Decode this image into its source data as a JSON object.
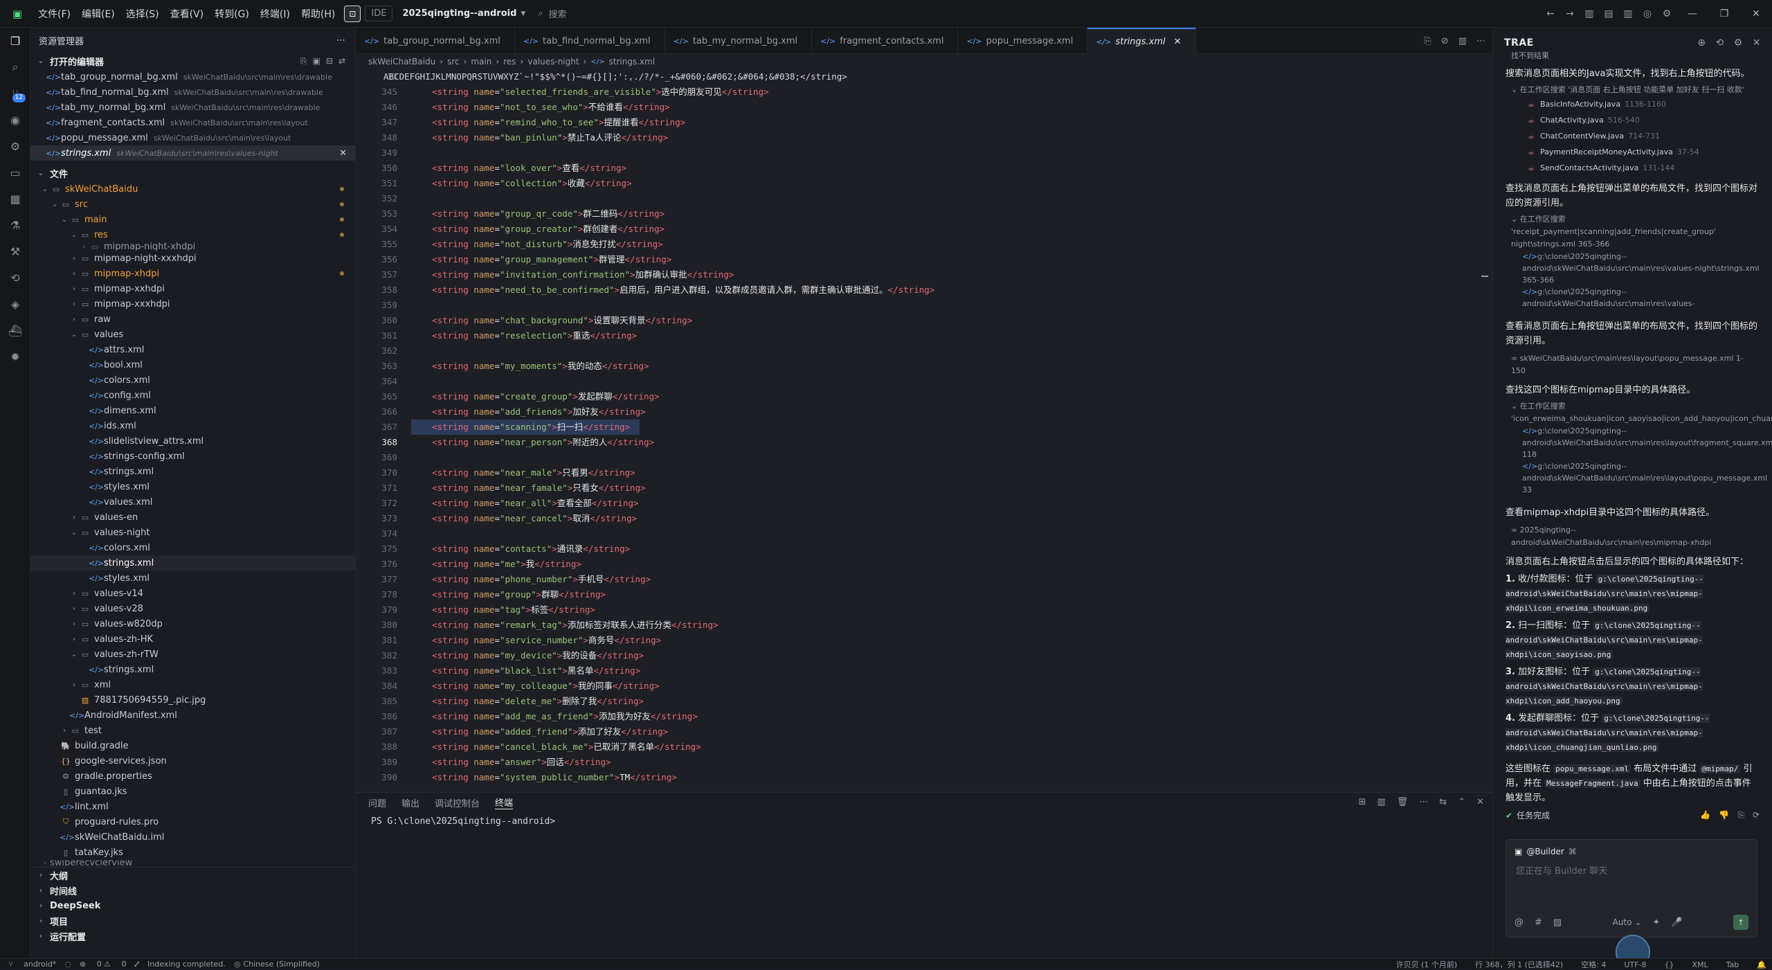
{
  "titlebar": {
    "menus": [
      "文件(F)",
      "编辑(E)",
      "选择(S)",
      "查看(V)",
      "转到(G)",
      "终端(I)",
      "帮助(H)"
    ],
    "ide_label": "IDE",
    "project": "2025qingting--android",
    "search_placeholder": "搜索"
  },
  "sidebar": {
    "title": "资源管理器",
    "open_editors_title": "打开的编辑器",
    "open_editors": [
      {
        "name": "tab_group_normal_bg.xml",
        "path": "skWeiChatBaidu\\src\\main\\res\\drawable"
      },
      {
        "name": "tab_find_normal_bg.xml",
        "path": "skWeiChatBaidu\\src\\main\\res\\drawable"
      },
      {
        "name": "tab_my_normal_bg.xml",
        "path": "skWeiChatBaidu\\src\\main\\res\\drawable"
      },
      {
        "name": "fragment_contacts.xml",
        "path": "skWeiChatBaidu\\src\\main\\res\\layout"
      },
      {
        "name": "popu_message.xml",
        "path": "skWeiChatBaidu\\src\\main\\res\\layout"
      },
      {
        "name": "strings.xml",
        "path": "skWeiChatBaidu\\src\\main\\res\\values-night"
      }
    ],
    "files_title": "文件",
    "tree": {
      "root": "skWeiChatBaidu",
      "src": "src",
      "main": "main",
      "res": "res",
      "mipmap_night_xhdpi": "mipmap-night-xhdpi",
      "mipmap_night_xxxhdpi": "mipmap-night-xxxhdpi",
      "mipmap_xhdpi": "mipmap-xhdpi",
      "mipmap_xxhdpi": "mipmap-xxhdpi",
      "mipmap_xxxhdpi": "mipmap-xxxhdpi",
      "raw": "raw",
      "values": "values",
      "values_files": [
        "attrs.xml",
        "bool.xml",
        "colors.xml",
        "config.xml",
        "dimens.xml",
        "ids.xml",
        "slidelistview_attrs.xml",
        "strings-config.xml",
        "strings.xml",
        "styles.xml",
        "values.xml"
      ],
      "values_en": "values-en",
      "values_night": "values-night",
      "values_night_files": [
        "colors.xml",
        "strings.xml",
        "styles.xml"
      ],
      "values_v14": "values-v14",
      "values_v28": "values-v28",
      "values_w820dp": "values-w820dp",
      "values_zh_hk": "values-zh-HK",
      "values_zh_rtw": "values-zh-rTW",
      "zh_rtw_strings": "strings.xml",
      "xml": "xml",
      "pic": "7881750694559_.pic.jpg",
      "manifest": "AndroidManifest.xml",
      "test": "test",
      "root_files": [
        "build.gradle",
        "google-services.json",
        "gradle.properties",
        "guantao.jks",
        "lint.xml",
        "proguard-rules.pro",
        "skWeiChatBaidu.iml",
        "tataKey.jks"
      ],
      "cut_folder": "swiperecyclerview"
    },
    "bottom_sections": [
      "大纲",
      "时间线",
      "DeepSeek",
      "项目",
      "运行配置"
    ]
  },
  "editor": {
    "tabs": [
      "tab_group_normal_bg.xml",
      "tab_find_normal_bg.xml",
      "tab_my_normal_bg.xml",
      "fragment_contacts.xml",
      "popu_message.xml",
      "strings.xml"
    ],
    "breadcrumb": [
      "skWeiChatBaidu",
      "src",
      "main",
      "res",
      "values-night",
      "strings.xml"
    ],
    "sticky_line": {
      "num": "33",
      "text": "ABCDEFGHIJKLMNOPQRSTUVWXYZ`~!\"$$%^*()~=#{}[];':,./?/*-_+&#060;&#062;&#064;&#038;</string>"
    },
    "current_line": "368",
    "lines": [
      {
        "n": "345",
        "name": "selected_friends_are_visible",
        "val": "选中的朋友可见"
      },
      {
        "n": "346",
        "name": "not_to_see_who",
        "val": "不给谁看"
      },
      {
        "n": "347",
        "name": "remind_who_to_see",
        "val": "提醒谁看"
      },
      {
        "n": "348",
        "name": "ban_pinlun",
        "val": "禁止Ta人评论"
      },
      {
        "n": "349"
      },
      {
        "n": "350",
        "name": "look_over",
        "val": "查看"
      },
      {
        "n": "351",
        "name": "collection",
        "val": "收藏"
      },
      {
        "n": "352"
      },
      {
        "n": "353",
        "name": "group_qr_code",
        "val": "群二维码"
      },
      {
        "n": "354",
        "name": "group_creator",
        "val": "群创建者"
      },
      {
        "n": "355",
        "name": "not_disturb",
        "val": "消息免打扰"
      },
      {
        "n": "356",
        "name": "group_management",
        "val": "群管理"
      },
      {
        "n": "357",
        "name": "invitation_confirmation",
        "val": "加群确认审批"
      },
      {
        "n": "358",
        "name": "need_to_be_confirmed",
        "val": "启用后，用户进入群组，以及群成员邀请入群，需群主确认审批通过。"
      },
      {
        "n": "359"
      },
      {
        "n": "360",
        "name": "chat_background",
        "val": "设置聊天背景"
      },
      {
        "n": "361",
        "name": "reselection",
        "val": "重选"
      },
      {
        "n": "362"
      },
      {
        "n": "363",
        "name": "my_moments",
        "val": "我的动态"
      },
      {
        "n": "364"
      },
      {
        "n": "365",
        "name": "create_group",
        "val": "发起群聊"
      },
      {
        "n": "366",
        "name": "add_friends",
        "val": "加好友"
      },
      {
        "n": "367",
        "name": "scanning",
        "val": "扫一扫",
        "sel": true
      },
      {
        "n": "368",
        "name": "near_person",
        "val": "附近的人"
      },
      {
        "n": "369"
      },
      {
        "n": "370",
        "name": "near_male",
        "val": "只看男"
      },
      {
        "n": "371",
        "name": "near_famale",
        "val": "只看女"
      },
      {
        "n": "372",
        "name": "near_all",
        "val": "查看全部"
      },
      {
        "n": "373",
        "name": "near_cancel",
        "val": "取消"
      },
      {
        "n": "374"
      },
      {
        "n": "375",
        "name": "contacts",
        "val": "通讯录"
      },
      {
        "n": "376",
        "name": "me",
        "val": "我"
      },
      {
        "n": "377",
        "name": "phone_number",
        "val": "手机号"
      },
      {
        "n": "378",
        "name": "group",
        "val": "群聊"
      },
      {
        "n": "379",
        "name": "tag",
        "val": "标签"
      },
      {
        "n": "380",
        "name": "remark_tag",
        "val": "添加标签对联系人进行分类"
      },
      {
        "n": "381",
        "name": "service_number",
        "val": "商务号"
      },
      {
        "n": "382",
        "name": "my_device",
        "val": "我的设备"
      },
      {
        "n": "383",
        "name": "black_list",
        "val": "黑名单"
      },
      {
        "n": "384",
        "name": "my_colleague",
        "val": "我的同事"
      },
      {
        "n": "385",
        "name": "delete_me",
        "val": "删除了我"
      },
      {
        "n": "386",
        "name": "add_me_as_friend",
        "val": "添加我为好友"
      },
      {
        "n": "387",
        "name": "added_friend",
        "val": "添加了好友"
      },
      {
        "n": "388",
        "name": "cancel_black_me",
        "val": "已取消了黑名单"
      },
      {
        "n": "389",
        "name": "answer",
        "val": "回话"
      },
      {
        "n": "390",
        "name": "system_public_number",
        "val": "TM"
      }
    ]
  },
  "panel": {
    "tabs": [
      "问题",
      "输出",
      "调试控制台",
      "终端"
    ],
    "prompt": "PS G:\\clone\\2025qingting--android>"
  },
  "chat": {
    "title": "TRAE",
    "not_found": "找不到结果",
    "p1": "搜索消息页面相关的Java实现文件，找到右上角按钮的代码。",
    "search1": "在工作区搜索 '消息页面 右上角按钮 功能菜单 加好友 扫一扫 收款'",
    "files1": [
      {
        "name": "BasicInfoActivity.java",
        "range": "1136-1160"
      },
      {
        "name": "ChatActivity.java",
        "range": "516-540"
      },
      {
        "name": "ChatContentView.java",
        "range": "714-731"
      },
      {
        "name": "PaymentReceiptMoneyActivity.java",
        "range": "37-54"
      },
      {
        "name": "SendContactsActivity.java",
        "range": "131-144"
      }
    ],
    "p2": "查找消息页面右上角按钮弹出菜单的布局文件，找到四个图标对应的资源引用。",
    "search2": "在工作区搜索 'receipt_payment|scanning|add_friends|create_group' night\\strings.xml 365-366",
    "paths2": [
      "g:\\clone\\2025qingting--android\\skWeiChatBaidu\\src\\main\\res\\values-night\\strings.xml 365-366",
      "g:\\clone\\2025qingting--android\\skWeiChatBaidu\\src\\main\\res\\values-"
    ],
    "p3": "查看消息页面右上角按钮弹出菜单的布局文件，找到四个图标的资源引用。",
    "ref3": "skWeiChatBaidu\\src\\main\\res\\layout\\popu_message.xml 1-150",
    "p4": "查找这四个图标在mipmap目录中的具体路径。",
    "search4": "在工作区搜索 'icon_erweima_shoukuan|icon_saoyisao|icon_add_haoyou|icon_chuar",
    "paths4": [
      "g:\\clone\\2025qingting--android\\skWeiChatBaidu\\src\\main\\res\\layout\\fragment_square.xml 118",
      "g:\\clone\\2025qingting--android\\skWeiChatBaidu\\src\\main\\res\\layout\\popu_message.xml 33"
    ],
    "p5": "查看mipmap-xhdpi目录中这四个图标的具体路径。",
    "ref5": "2025qingting--android\\skWeiChatBaidu\\src\\main\\res\\mipmap-xhdpi",
    "p6": "消息页面右上角按钮点击后显示的四个图标的具体路径如下：",
    "items": [
      {
        "num": "1.",
        "label": "收/付款图标：位于",
        "path": "g:\\clone\\2025qingting--android\\skWeiChatBaidu\\src\\main\\res\\mipmap-xhdpi\\icon_erweima_shoukuan.png"
      },
      {
        "num": "2.",
        "label": "扫一扫图标：位于",
        "path": "g:\\clone\\2025qingting--android\\skWeiChatBaidu\\src\\main\\res\\mipmap-xhdpi\\icon_saoyisao.png"
      },
      {
        "num": "3.",
        "label": "加好友图标：位于",
        "path": "g:\\clone\\2025qingting--android\\skWeiChatBaidu\\src\\main\\res\\mipmap-xhdpi\\icon_add_haoyou.png"
      },
      {
        "num": "4.",
        "label": "发起群聊图标：位于",
        "path": "g:\\clone\\2025qingting--android\\skWeiChatBaidu\\src\\main\\res\\mipmap-xhdpi\\icon_chuangjian_qunliao.png"
      }
    ],
    "p7a": "这些图标在",
    "p7b": "popu_message.xml",
    "p7c": "布局文件中通过",
    "p7d": "@mipmap/",
    "p7e": "引用，并在",
    "p7f": "MessageFragment.java",
    "p7g": "中由右上角按钮的点击事件触发显示。",
    "done": "任务完成",
    "agent": "@Builder",
    "input_placeholder": "您正在与 Builder 聊天",
    "mode": "Auto"
  },
  "statusbar": {
    "branch": "android*",
    "problems": "0",
    "warnings": "0",
    "indexing": "Indexing completed.",
    "language": "Chinese (Simplified)",
    "git": "许贝贝 (1 个月前)",
    "position": "行 368，列 1 (已选择42)",
    "spaces": "空格: 4",
    "encoding": "UTF-8",
    "filetype": "XML",
    "tab": "Tab"
  }
}
